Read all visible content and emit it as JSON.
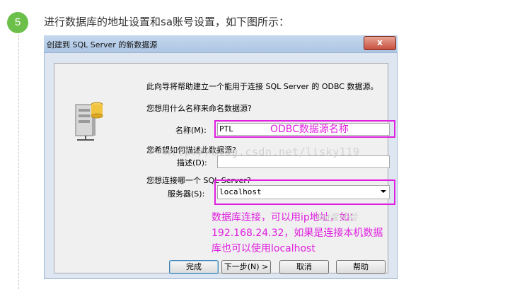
{
  "step": {
    "number": "5",
    "text": "进行数据库的地址设置和sa账号设置，如下图所示："
  },
  "dialog": {
    "title": "创建到 SQL Server 的新数据源",
    "close_glyph": "x",
    "intro": "此向导将帮助建立一个能用于连接 SQL Server 的 ODBC 数据源。",
    "q_name": "您想用什么名称来命名数据源?",
    "name_label": "名称(M):",
    "name_value": "PTL",
    "q_desc": "您希望如何描述此数据源?",
    "desc_label": "描述(D):",
    "desc_value": "",
    "q_server": "您想连接哪一个 SQL Server?",
    "server_label": "服务器(S):",
    "server_value": "localhost",
    "buttons": {
      "finish": "完成",
      "next": "下一步(N) >",
      "cancel": "取消",
      "help": "帮助"
    }
  },
  "annotations": {
    "odbc_name": "ODBC数据源名称",
    "server_note": [
      "数据库连接，可以用ip地址，如：",
      "192.168.24.32，如果是连接本机数据",
      "库也可以使用localhost"
    ]
  },
  "watermarks": {
    "csdn": "http://blog.csdn.net/lisky119",
    "baidu": "Bai度经验"
  },
  "colors": {
    "highlight": "#e01fe0",
    "step_badge": "#6cc04a"
  }
}
